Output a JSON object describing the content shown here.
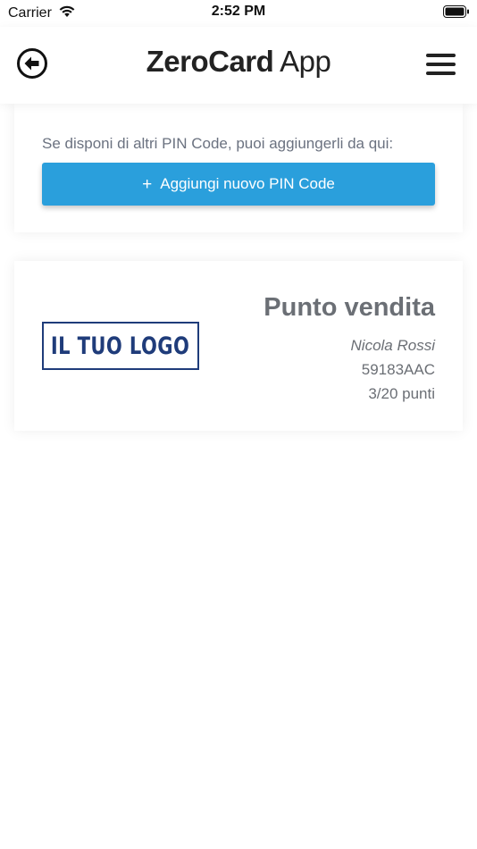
{
  "status_bar": {
    "carrier": "Carrier",
    "time": "2:52 PM"
  },
  "header": {
    "title_brand": "ZeroCard",
    "title_suffix": "App",
    "icons": {
      "back": "back-arrow-circle-icon",
      "menu": "hamburger-menu-icon"
    }
  },
  "pin_card": {
    "text": "Se disponi di altri PIN Code, puoi aggiungerli da qui:",
    "button_label": "Aggiungi nuovo PIN Code",
    "button_icon": "+"
  },
  "store_card": {
    "logo_text": "IL TUO LOGO",
    "title": "Punto vendita",
    "owner": "Nicola Rossi",
    "code": "59183AAC",
    "points": "3/20 punti"
  },
  "colors": {
    "accent": "#2a9fdc",
    "logo": "#1f3c7a",
    "text_muted": "#6b6f75"
  }
}
